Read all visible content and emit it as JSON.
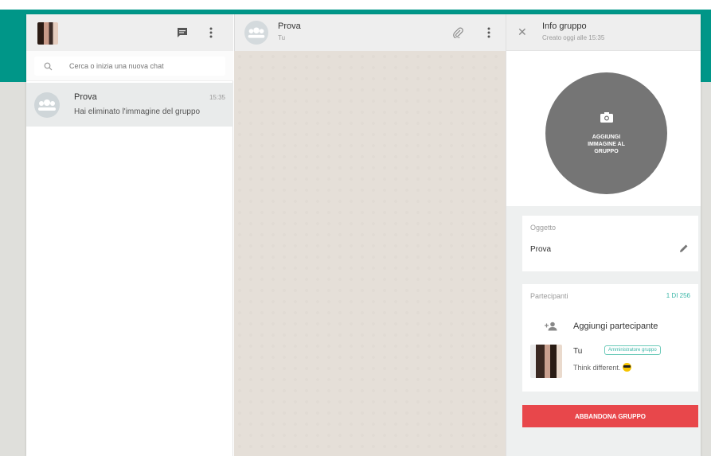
{
  "left": {
    "search": {
      "placeholder": "Cerca o inizia una nuova chat"
    },
    "chats": [
      {
        "name": "Prova",
        "time": "15:35",
        "preview": "Hai eliminato l'immagine del gruppo"
      }
    ]
  },
  "center": {
    "title": "Prova",
    "subtitle": "Tu"
  },
  "info": {
    "title": "Info gruppo",
    "created": "Creato oggi alle 15:35",
    "add_photo": "AGGIUNGI IMMAGINE AL GRUPPO",
    "subject_label": "Oggetto",
    "subject_value": "Prova",
    "participants_label": "Partecipanti",
    "participants_count": "1 DI 256",
    "add_participant": "Aggiungi partecipante",
    "member": {
      "name": "Tu",
      "badge": "Amministratore gruppo",
      "status": "Think different."
    },
    "leave": "ABBANDONA GRUPPO"
  },
  "colors": {
    "accent": "#009688",
    "danger": "#e8474b",
    "badge": "#3ab6a7"
  },
  "icons": [
    "new-chat-icon",
    "menu-icon",
    "search-icon",
    "group-avatar-icon",
    "attach-icon",
    "close-icon",
    "camera-icon",
    "pencil-icon",
    "add-person-icon"
  ]
}
